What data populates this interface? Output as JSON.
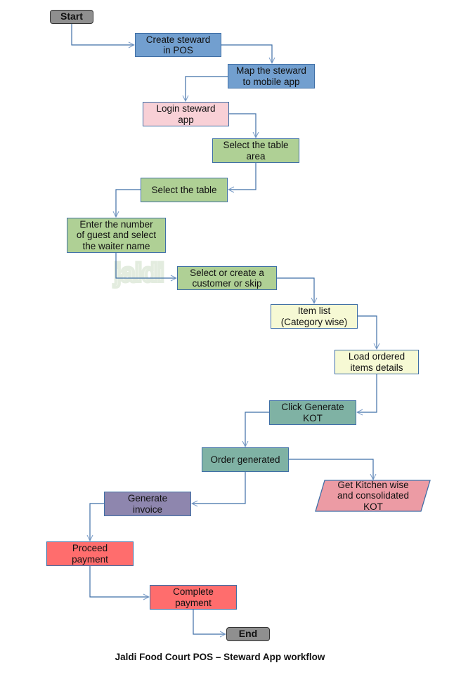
{
  "diagram": {
    "title": "Jaldi Food Court POS – Steward App workflow",
    "watermark": "jaldi",
    "colors": {
      "terminal": "#8f8f8f",
      "blue": "#729fcf",
      "pink": "#f8d0d6",
      "green": "#afd095",
      "yellow": "#f6f9d4",
      "teal": "#7fb2a4",
      "purple": "#8e86ae",
      "red": "#ff6d6d",
      "rose": "#ec9ba4",
      "connector": "#3f6fa6"
    },
    "nodes": [
      {
        "id": "start",
        "label": "Start",
        "shape": "terminal"
      },
      {
        "id": "create-steward",
        "label": "Create steward\nin POS",
        "shape": "process"
      },
      {
        "id": "map-steward",
        "label": "Map the steward\nto mobile app",
        "shape": "process"
      },
      {
        "id": "login-steward",
        "label": "Login steward\napp",
        "shape": "process"
      },
      {
        "id": "select-table-area",
        "label": "Select the table\narea",
        "shape": "process"
      },
      {
        "id": "select-table",
        "label": "Select the table",
        "shape": "process"
      },
      {
        "id": "enter-guests",
        "label": "Enter the number\nof guest and select\nthe waiter name",
        "shape": "process"
      },
      {
        "id": "select-customer",
        "label": "Select or create a\ncustomer or skip",
        "shape": "process"
      },
      {
        "id": "item-list",
        "label": "Item list\n(Category wise)",
        "shape": "process"
      },
      {
        "id": "load-items",
        "label": "Load ordered\nitems details",
        "shape": "process"
      },
      {
        "id": "generate-kot",
        "label": "Click Generate\nKOT",
        "shape": "process"
      },
      {
        "id": "order-generated",
        "label": "Order generated",
        "shape": "process"
      },
      {
        "id": "kitchen-kot",
        "label": "Get Kitchen wise\nand consolidated\nKOT",
        "shape": "data"
      },
      {
        "id": "generate-invoice",
        "label": "Generate\ninvoice",
        "shape": "process"
      },
      {
        "id": "proceed-payment",
        "label": "Proceed\npayment",
        "shape": "process"
      },
      {
        "id": "complete-payment",
        "label": "Complete\npayment",
        "shape": "process"
      },
      {
        "id": "end",
        "label": "End",
        "shape": "terminal"
      }
    ],
    "edges": [
      {
        "from": "start",
        "to": "create-steward"
      },
      {
        "from": "create-steward",
        "to": "map-steward"
      },
      {
        "from": "map-steward",
        "to": "login-steward"
      },
      {
        "from": "login-steward",
        "to": "select-table-area"
      },
      {
        "from": "select-table-area",
        "to": "select-table"
      },
      {
        "from": "select-table",
        "to": "enter-guests"
      },
      {
        "from": "enter-guests",
        "to": "select-customer"
      },
      {
        "from": "select-customer",
        "to": "item-list"
      },
      {
        "from": "item-list",
        "to": "load-items"
      },
      {
        "from": "load-items",
        "to": "generate-kot"
      },
      {
        "from": "generate-kot",
        "to": "order-generated"
      },
      {
        "from": "order-generated",
        "to": "kitchen-kot"
      },
      {
        "from": "order-generated",
        "to": "generate-invoice"
      },
      {
        "from": "generate-invoice",
        "to": "proceed-payment"
      },
      {
        "from": "proceed-payment",
        "to": "complete-payment"
      },
      {
        "from": "complete-payment",
        "to": "end"
      }
    ]
  }
}
